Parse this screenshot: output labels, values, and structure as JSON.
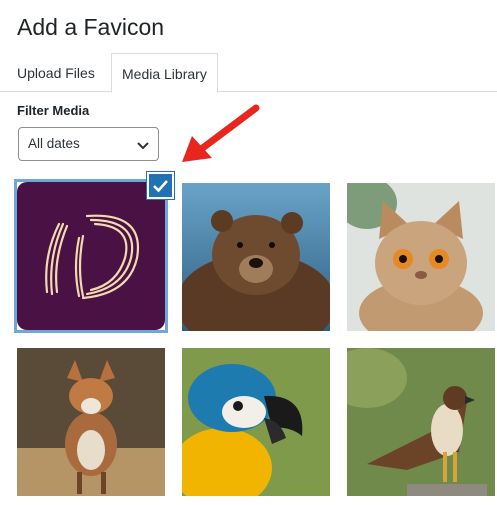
{
  "dialog": {
    "title": "Add a Favicon"
  },
  "tabs": [
    {
      "label": "Upload Files",
      "active": false
    },
    {
      "label": "Media Library",
      "active": true
    }
  ],
  "filter": {
    "label": "Filter Media",
    "selected": "All dates"
  },
  "media": [
    {
      "name": "site-logo-id",
      "selected": true
    },
    {
      "name": "bear",
      "selected": false
    },
    {
      "name": "cat",
      "selected": false
    },
    {
      "name": "fox",
      "selected": false
    },
    {
      "name": "macaw",
      "selected": false
    },
    {
      "name": "hawk",
      "selected": false
    }
  ],
  "colors": {
    "accent": "#2271b1",
    "arrow": "#e8261e",
    "logo_bg": "#4a1145",
    "logo_fg": "#f3d9b0"
  }
}
